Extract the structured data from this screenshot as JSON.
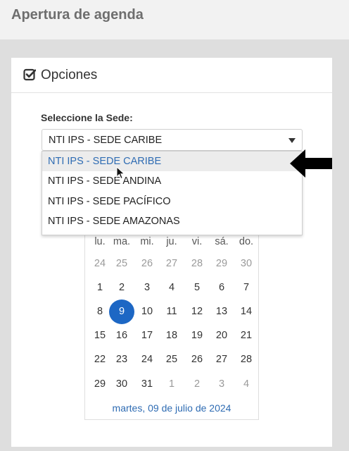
{
  "page": {
    "title": "Apertura de agenda"
  },
  "panel": {
    "title": "Opciones"
  },
  "sede": {
    "label": "Seleccione la Sede:",
    "selected": "NTI IPS - SEDE CARIBE",
    "options": [
      "NTI IPS - SEDE CARIBE",
      "NTI IPS - SEDE ANDINA",
      "NTI IPS - SEDE PACÍFICO",
      "NTI IPS - SEDE AMAZONAS"
    ]
  },
  "calendar": {
    "weekdays": [
      "lu.",
      "ma.",
      "mi.",
      "ju.",
      "vi.",
      "sá.",
      "do."
    ],
    "weeks": [
      [
        "24",
        "25",
        "26",
        "27",
        "28",
        "29",
        "30"
      ],
      [
        "1",
        "2",
        "3",
        "4",
        "5",
        "6",
        "7"
      ],
      [
        "8",
        "9",
        "10",
        "11",
        "12",
        "13",
        "14"
      ],
      [
        "15",
        "16",
        "17",
        "18",
        "19",
        "20",
        "21"
      ],
      [
        "22",
        "23",
        "24",
        "25",
        "26",
        "27",
        "28"
      ],
      [
        "29",
        "30",
        "31",
        "1",
        "2",
        "3",
        "4"
      ]
    ],
    "selected_day": "9",
    "selected_date_text": "martes, 09 de julio de 2024"
  },
  "colors": {
    "accent": "#1d67c4",
    "link": "#2f6cb3"
  },
  "icons": [
    "check-square-icon",
    "caret-down-icon",
    "mouse-cursor-icon",
    "arrow-left-icon"
  ]
}
